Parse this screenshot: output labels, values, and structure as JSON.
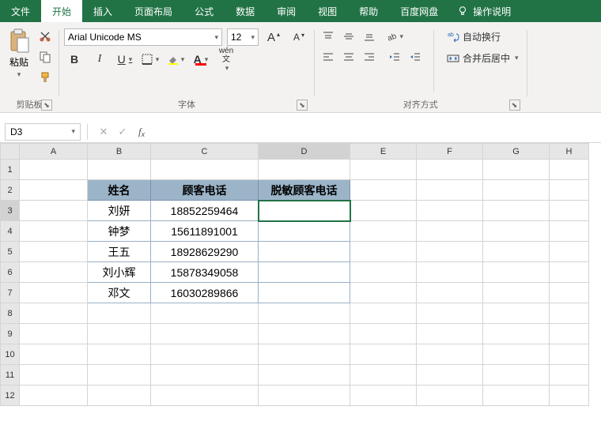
{
  "tabs": {
    "file": "文件",
    "home": "开始",
    "insert": "插入",
    "page_layout": "页面布局",
    "formulas": "公式",
    "data": "数据",
    "review": "审阅",
    "view": "视图",
    "help": "帮助",
    "baidu": "百度网盘",
    "tell_me": "操作说明"
  },
  "ribbon": {
    "clipboard": {
      "label": "剪贴板",
      "paste": "粘贴"
    },
    "font": {
      "label": "字体",
      "name": "Arial Unicode MS",
      "size": "12",
      "bold": "B",
      "italic": "I",
      "underline": "U",
      "ruby": "wén"
    },
    "alignment": {
      "label": "对齐方式",
      "wrap": "自动换行",
      "merge": "合并后居中"
    }
  },
  "formula_bar": {
    "name_box": "D3",
    "formula": ""
  },
  "columns": [
    "A",
    "B",
    "C",
    "D",
    "E",
    "F",
    "G",
    "H"
  ],
  "rows": [
    "1",
    "2",
    "3",
    "4",
    "5",
    "6",
    "7",
    "8",
    "9",
    "10",
    "11",
    "12"
  ],
  "active_cell": "D3",
  "headers": {
    "b": "姓名",
    "c": "顾客电话",
    "d": "脱敏顾客电话"
  },
  "data_rows": [
    {
      "name": "刘妍",
      "phone": "18852259464"
    },
    {
      "name": "钟梦",
      "phone": "15611891001"
    },
    {
      "name": "王五",
      "phone": "18928629290"
    },
    {
      "name": "刘小辉",
      "phone": "15878349058"
    },
    {
      "name": "邓文",
      "phone": "16030289866"
    }
  ]
}
